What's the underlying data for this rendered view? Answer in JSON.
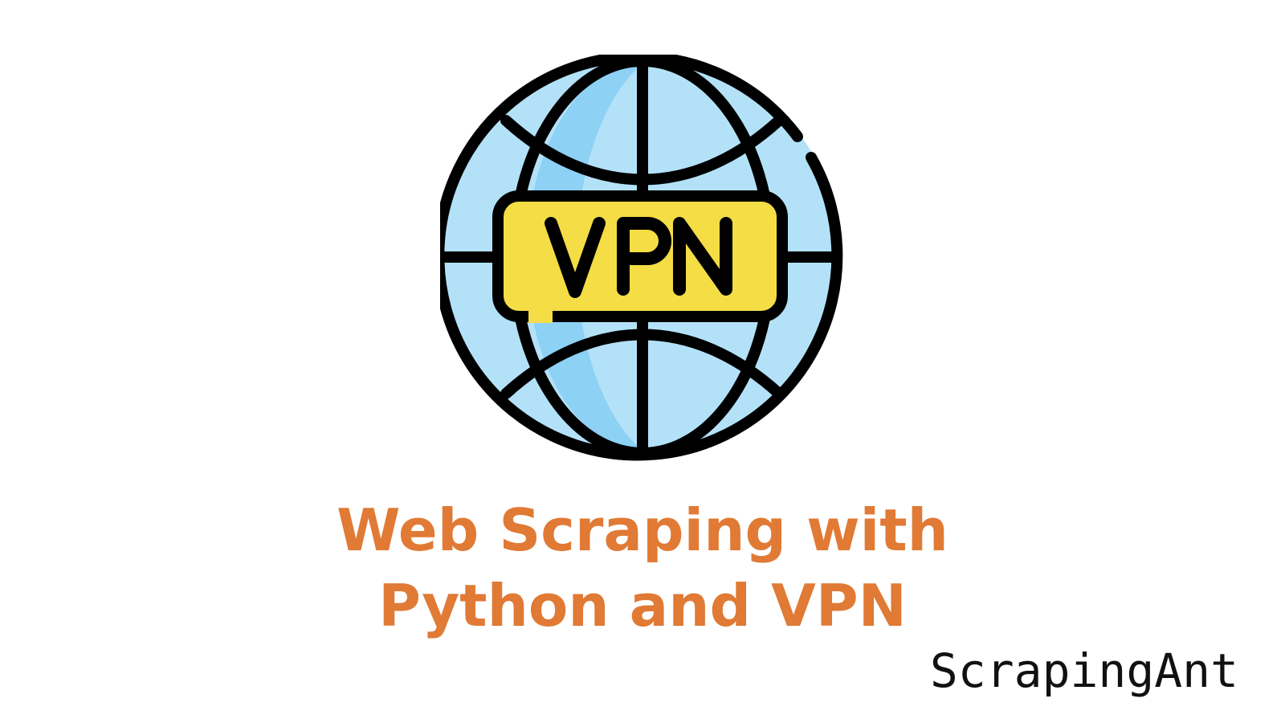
{
  "logo": {
    "icon": "vpn-globe-icon",
    "label": "VPN",
    "colors": {
      "globe_light": "#b3e2f8",
      "globe_dark": "#8dd1f5",
      "badge": "#f4dd45",
      "outline": "#000000"
    }
  },
  "title": {
    "line1": "Web Scraping with",
    "line2": "Python and VPN",
    "color": "#e07a35"
  },
  "brand": {
    "name": "ScrapingAnt"
  }
}
